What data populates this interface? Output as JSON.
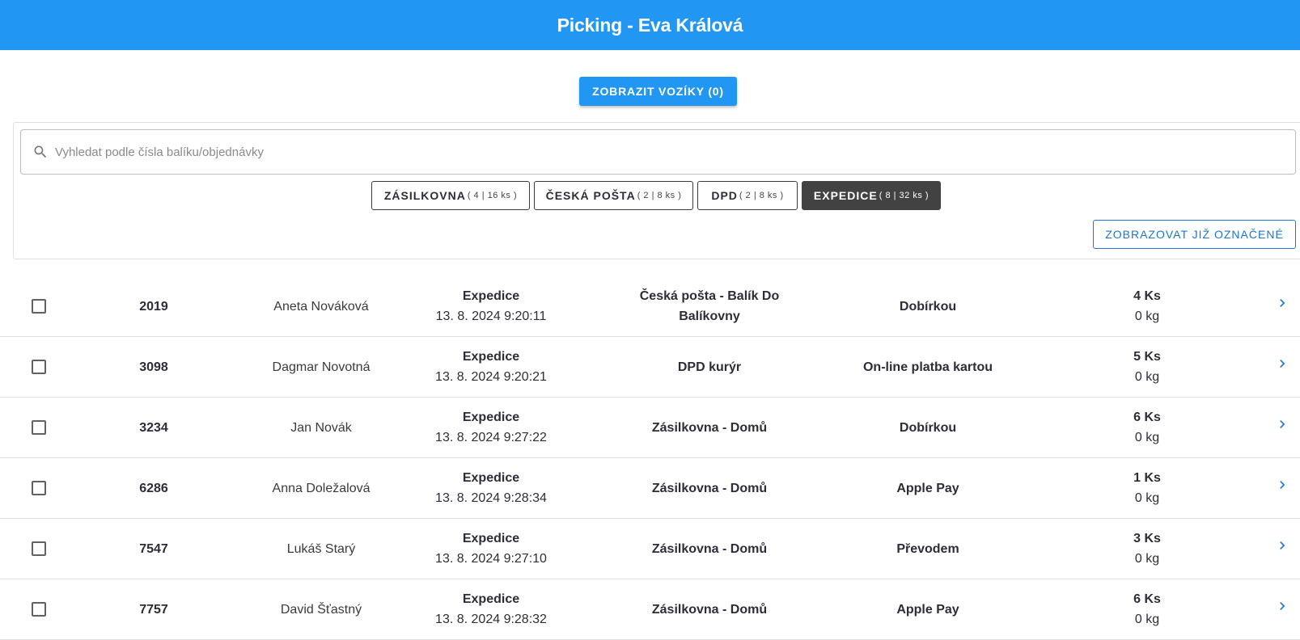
{
  "header": {
    "title": "Picking - Eva Králová"
  },
  "actions": {
    "carts_label": "ZOBRAZIT VOZÍKY (0)",
    "show_marked_label": "ZOBRAZOVAT JIŽ OZNAČENÉ"
  },
  "search": {
    "placeholder": "Vyhledat podle čísla balíku/objednávky",
    "value": ""
  },
  "tabs": [
    {
      "label": "ZÁSILKOVNA",
      "count": "( 4 | 16 ks )",
      "active": false
    },
    {
      "label": "ČESKÁ POŠTA",
      "count": "( 2 | 8 ks )",
      "active": false
    },
    {
      "label": "DPD",
      "count": "( 2 | 8 ks )",
      "active": false
    },
    {
      "label": "EXPEDICE",
      "count": "( 8 | 32 ks )",
      "active": true
    }
  ],
  "orders": [
    {
      "id": "2019",
      "name": "Aneta Nováková",
      "status": "Expedice",
      "datetime": "13. 8. 2024 9:20:11",
      "carrier_line1": "Česká pošta - Balík Do",
      "carrier_line2": "Balíkovny",
      "payment": "Dobírkou",
      "qty": "4 Ks",
      "weight": "0 kg"
    },
    {
      "id": "3098",
      "name": "Dagmar Novotná",
      "status": "Expedice",
      "datetime": "13. 8. 2024 9:20:21",
      "carrier_line1": "DPD kurýr",
      "carrier_line2": "",
      "payment": "On-line platba kartou",
      "qty": "5 Ks",
      "weight": "0 kg"
    },
    {
      "id": "3234",
      "name": "Jan Novák",
      "status": "Expedice",
      "datetime": "13. 8. 2024 9:27:22",
      "carrier_line1": "Zásilkovna - Domů",
      "carrier_line2": "",
      "payment": "Dobírkou",
      "qty": "6 Ks",
      "weight": "0 kg"
    },
    {
      "id": "6286",
      "name": "Anna Doležalová",
      "status": "Expedice",
      "datetime": "13. 8. 2024 9:28:34",
      "carrier_line1": "Zásilkovna - Domů",
      "carrier_line2": "",
      "payment": "Apple Pay",
      "qty": "1 Ks",
      "weight": "0 kg"
    },
    {
      "id": "7547",
      "name": "Lukáš Starý",
      "status": "Expedice",
      "datetime": "13. 8. 2024 9:27:10",
      "carrier_line1": "Zásilkovna - Domů",
      "carrier_line2": "",
      "payment": "Převodem",
      "qty": "3 Ks",
      "weight": "0 kg"
    },
    {
      "id": "7757",
      "name": "David Šťastný",
      "status": "Expedice",
      "datetime": "13. 8. 2024 9:28:32",
      "carrier_line1": "Zásilkovna - Domů",
      "carrier_line2": "",
      "payment": "Apple Pay",
      "qty": "6 Ks",
      "weight": "0 kg"
    }
  ],
  "colors": {
    "primary": "#2196f3",
    "active_tab": "#424242",
    "outline_button": "#1976d2"
  },
  "icons": {
    "search": "search-icon",
    "row_open": "chevron-right-icon"
  }
}
